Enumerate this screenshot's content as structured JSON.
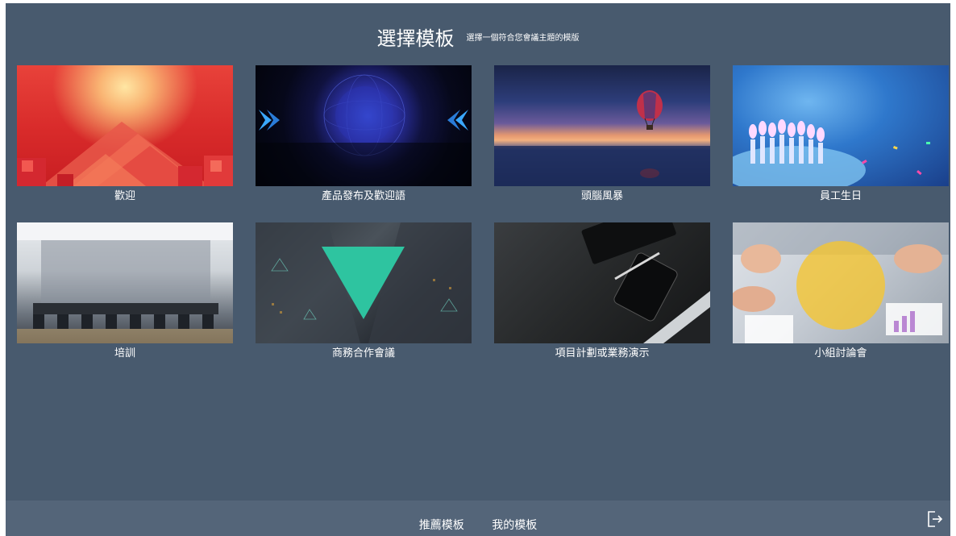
{
  "header": {
    "title": "選擇模板",
    "subtitle": "選擇一個符合您會議主題的模版"
  },
  "templates": [
    {
      "label": "歡迎"
    },
    {
      "label": "產品發布及歡迎語"
    },
    {
      "label": "頭腦風暴"
    },
    {
      "label": "員工生日"
    },
    {
      "label": "培訓"
    },
    {
      "label": "商務合作會議"
    },
    {
      "label": "項目計劃或業務演示"
    },
    {
      "label": "小組討論會"
    }
  ],
  "footer": {
    "tab_recommended": "推薦模板",
    "tab_mine": "我的模板",
    "exit_icon": "exit-icon"
  },
  "colors": {
    "background": "#485a6e",
    "footer": "#546579",
    "text": "#ffffff"
  }
}
